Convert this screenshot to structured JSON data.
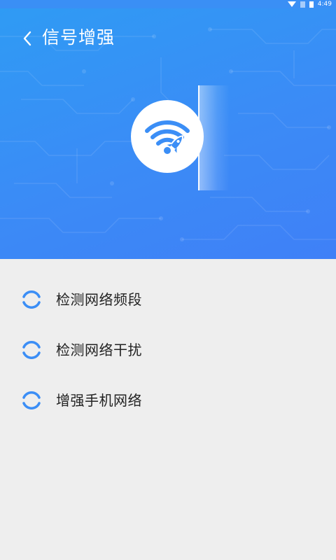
{
  "status_bar": {
    "time": "4:49"
  },
  "header": {
    "title": "信号增强",
    "back_icon": "chevron-left-icon",
    "center_icon": "wifi-rocket-icon",
    "gradient_colors": [
      "#2f9bf4",
      "#3f80f7"
    ]
  },
  "tasks": {
    "items": [
      {
        "label": "检测网络频段",
        "icon": "loading-spinner-icon"
      },
      {
        "label": "检测网络干扰",
        "icon": "loading-spinner-icon"
      },
      {
        "label": "增强手机网络",
        "icon": "loading-spinner-icon"
      }
    ]
  },
  "colors": {
    "accent": "#3b8ef6",
    "background": "#eeeeee",
    "text": "#222222"
  }
}
